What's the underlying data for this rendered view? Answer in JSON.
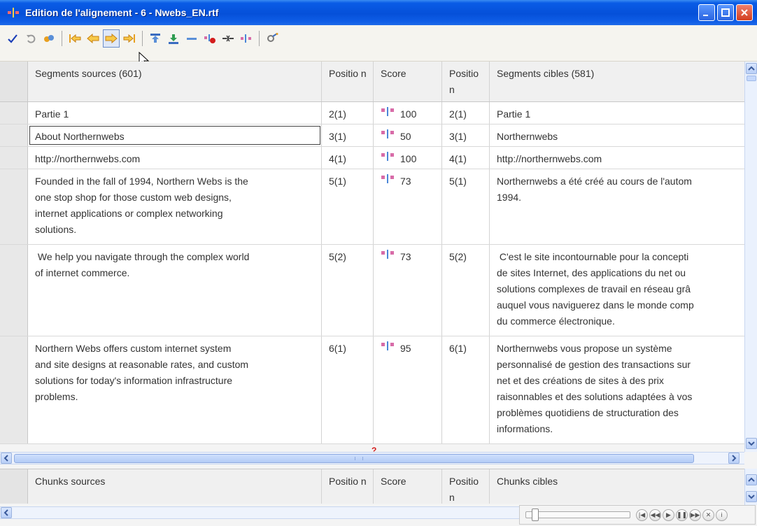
{
  "window": {
    "title": "Edition de l'alignement - 6 - Nwebs_EN.rtf"
  },
  "toolbar": {
    "buttons": [
      {
        "name": "validate-button",
        "icon": "checkmark-icon"
      },
      {
        "name": "undo-button",
        "icon": "undo-icon"
      },
      {
        "name": "redo-button",
        "icon": "redo-icon"
      },
      {
        "name": "first-button",
        "icon": "first-arrow-icon"
      },
      {
        "name": "previous-button",
        "icon": "left-arrow-icon"
      },
      {
        "name": "next-button",
        "icon": "right-arrow-icon"
      },
      {
        "name": "last-button",
        "icon": "last-arrow-icon"
      },
      {
        "name": "move-up-button",
        "icon": "move-up-icon"
      },
      {
        "name": "move-down-button",
        "icon": "move-down-icon"
      },
      {
        "name": "merge-button",
        "icon": "merge-icon"
      },
      {
        "name": "delete-link-button",
        "icon": "delete-link-icon"
      },
      {
        "name": "join-button",
        "icon": "join-icon"
      },
      {
        "name": "split-button",
        "icon": "split-icon"
      },
      {
        "name": "settings-button",
        "icon": "gear-wand-icon"
      }
    ]
  },
  "segments": {
    "columns": {
      "source": "Segments sources (601)",
      "position_src": "Positio n",
      "score": "Score",
      "position_tgt": "Positio n",
      "target": "Segments cibles (581)"
    },
    "rows": [
      {
        "source": [
          "Partie 1"
        ],
        "pos_src": "2(1)",
        "score": "100",
        "pos_tgt": "2(1)",
        "target": [
          "Partie 1"
        ]
      },
      {
        "source": [
          "About Northernwebs"
        ],
        "pos_src": "3(1)",
        "score": "50",
        "pos_tgt": "3(1)",
        "target": [
          "Northernwebs"
        ]
      },
      {
        "source": [
          "http://northernwebs.com"
        ],
        "pos_src": "4(1)",
        "score": "100",
        "pos_tgt": "4(1)",
        "target": [
          "http://northernwebs.com"
        ]
      },
      {
        "source": [
          "Founded in the fall of 1994, Northern Webs is the",
          "one stop shop for those custom web designs,",
          "internet applications or complex networking",
          "solutions."
        ],
        "pos_src": "5(1)",
        "score": "73",
        "pos_tgt": "5(1)",
        "target": [
          "Northernwebs a été créé au cours de l'autom",
          "1994."
        ]
      },
      {
        "source": [
          " We help you navigate through the complex world",
          "of internet commerce."
        ],
        "pos_src": "5(2)",
        "score": "73",
        "pos_tgt": "5(2)",
        "target": [
          " C'est le site incontournable pour la concepti",
          "de sites Internet, des applications du net ou",
          "solutions complexes de travail en réseau grâ",
          "auquel vous naviguerez dans le monde comp",
          "du commerce électronique."
        ]
      },
      {
        "source": [
          "Northern Webs offers custom internet system",
          "and site designs at reasonable rates, and custom",
          "solutions for today's information infrastructure",
          "problems."
        ],
        "pos_src": "6(1)",
        "score": "95",
        "pos_tgt": "6(1)",
        "target": [
          "Northernwebs vous propose un système",
          "personnalisé de gestion des transactions sur",
          "net et des créations de sites à des prix",
          "raisonnables et des solutions adaptées à vos",
          "problèmes quotidiens de structuration des",
          "informations."
        ]
      }
    ]
  },
  "chunks": {
    "columns": {
      "source": "Chunks sources",
      "position_src": "Positio n",
      "score": "Score",
      "position_tgt": "Positio n",
      "target": "Chunks cibles"
    }
  },
  "marker": "?",
  "colors": {
    "titlebar": "#0550d9",
    "arrow_orange": "#e8a020",
    "score_icon_pink": "#d86ca8",
    "score_icon_blue": "#4a86d8",
    "marker_red": "#d31c1c"
  }
}
